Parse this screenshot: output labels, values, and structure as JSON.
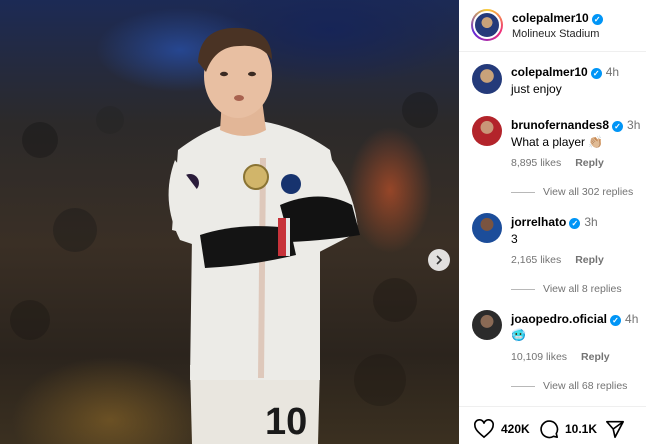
{
  "post": {
    "author": "colepalmer10",
    "location": "Molineux Stadium",
    "shirt_number": "10"
  },
  "caption": {
    "author": "colepalmer10",
    "time": "4h",
    "text": "just enjoy"
  },
  "comments": [
    {
      "author": "brunofernandes8",
      "time": "3h",
      "text": "What a player 👏🏼",
      "likes": "8,895 likes",
      "reply": "Reply",
      "view_replies": "View all 302 replies"
    },
    {
      "author": "jorrelhato",
      "time": "3h",
      "text": "3",
      "likes": "2,165 likes",
      "reply": "Reply",
      "view_replies": "View all 8 replies"
    },
    {
      "author": "joaopedro.oficial",
      "time": "4h",
      "text": "🥶",
      "likes": "10,109 likes",
      "reply": "Reply",
      "view_replies": "View all 68 replies"
    }
  ],
  "actions": {
    "likes_count": "420K",
    "comments_count": "10.1K"
  },
  "colors": {
    "verified": "#0095f6",
    "muted_text": "#737373"
  },
  "icons": [
    "verified-badge-icon",
    "chevron-right-icon",
    "heart-icon",
    "comment-icon",
    "share-icon"
  ]
}
